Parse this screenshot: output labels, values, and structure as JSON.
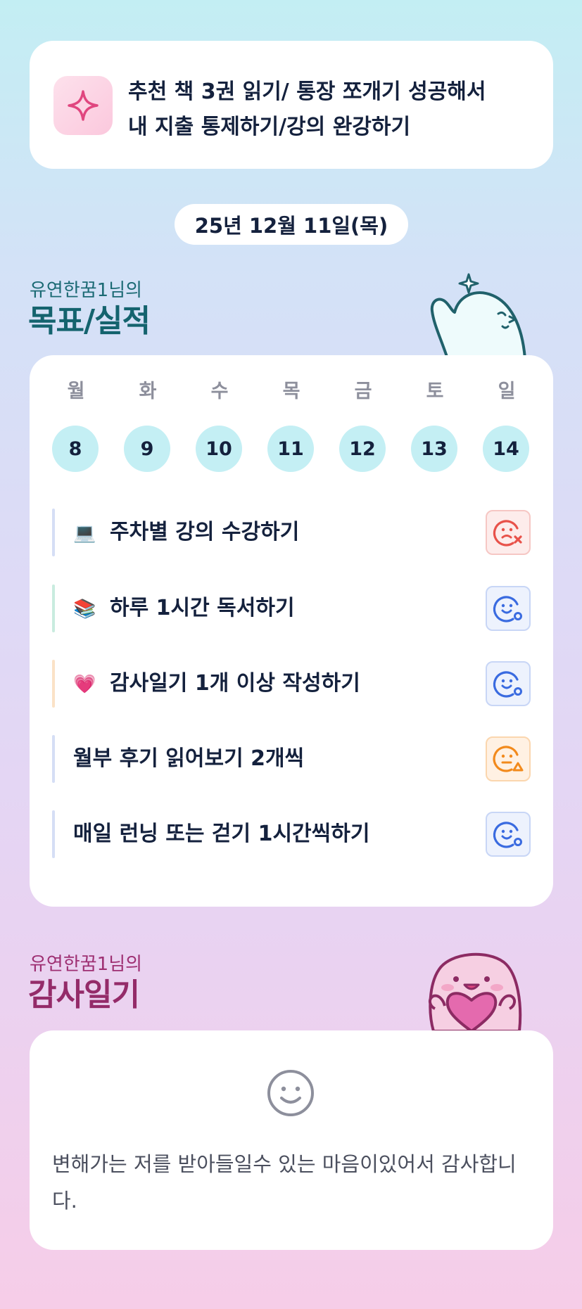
{
  "goal_banner": {
    "icon": "sparkle-icon",
    "line1": "추천 책 3권 읽기/ 통장 쪼개기 성공해서",
    "line2": "내 지출 통제하기/강의 완강하기"
  },
  "date": "25년 12월 11일(목)",
  "goal_section": {
    "subtitle": "유연한꿈1님의",
    "title": "목표/실적"
  },
  "week": {
    "days": [
      {
        "label": "월",
        "num": "8"
      },
      {
        "label": "화",
        "num": "9"
      },
      {
        "label": "수",
        "num": "10"
      },
      {
        "label": "목",
        "num": "11"
      },
      {
        "label": "금",
        "num": "12"
      },
      {
        "label": "토",
        "num": "13"
      },
      {
        "label": "일",
        "num": "14"
      }
    ]
  },
  "tasks": [
    {
      "emoji": "💻",
      "label": "주차별 강의 수강하기",
      "status": "failed",
      "bar_color": "#d5def5"
    },
    {
      "emoji": "📚",
      "label": "하루 1시간 독서하기",
      "status": "done",
      "bar_color": "#c9ecdf"
    },
    {
      "emoji": "💗",
      "label": "감사일기 1개 이상 작성하기",
      "status": "done",
      "bar_color": "#fbe2c7"
    },
    {
      "emoji": "",
      "label": "월부 후기 읽어보기 2개씩",
      "status": "partial",
      "bar_color": "#d5def5"
    },
    {
      "emoji": "",
      "label": "매일 런닝 또는 걷기 1시간씩하기",
      "status": "done",
      "bar_color": "#d5def5"
    }
  ],
  "status_colors": {
    "failed": {
      "bg": "#fdeceb",
      "border": "#f6c7c4",
      "fg": "#e8524a"
    },
    "done": {
      "bg": "#edf2fd",
      "border": "#c8d6f6",
      "fg": "#3a6be0"
    },
    "partial": {
      "bg": "#fff1e3",
      "border": "#fbd6ae",
      "fg": "#f28a1c"
    }
  },
  "gratitude_section": {
    "subtitle": "유연한꿈1님의",
    "title": "감사일기"
  },
  "gratitude": {
    "icon": "smile-icon",
    "text": "변해가는 저를 받아들일수 있는 마음이있어서 감사합니다."
  }
}
